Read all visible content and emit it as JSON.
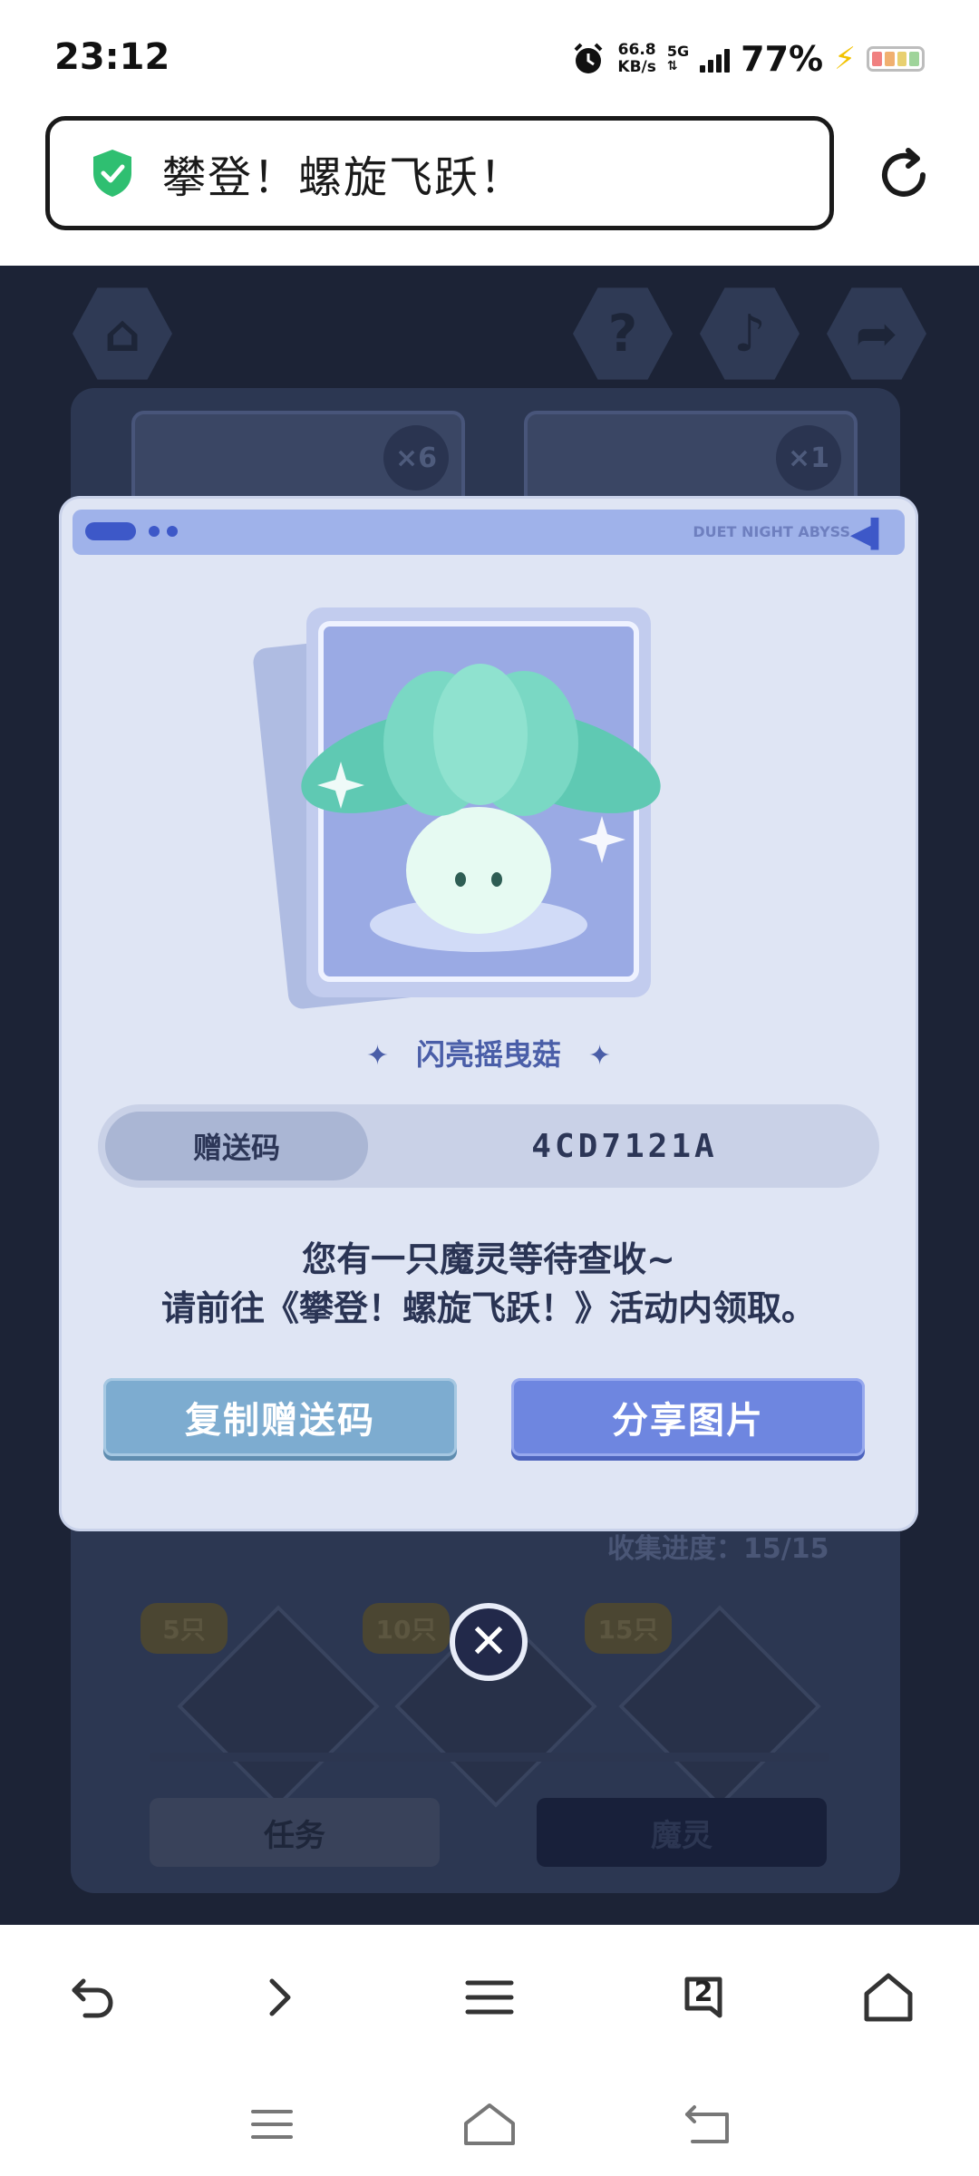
{
  "status_bar": {
    "time": "23:12",
    "net_speed_value": "66.8",
    "net_speed_unit": "KB/s",
    "network_type": "5G",
    "battery_percent": "77%",
    "icons": [
      "alarm-icon",
      "signal-icon",
      "charging-icon",
      "battery-icon"
    ]
  },
  "address_bar": {
    "title": "攀登！螺旋飞跃！",
    "secure_icon": "shield-check-icon",
    "reload_icon": "reload-icon",
    "accent_color": "#2fbf71"
  },
  "page": {
    "top_icons": [
      "home-icon",
      "help-icon",
      "music-icon",
      "share-icon"
    ],
    "card_counts": [
      "×6",
      "×1"
    ],
    "progress_text": "收集进度：15/15",
    "milestones": [
      "5只",
      "10只",
      "15只"
    ],
    "tabs": [
      "任务",
      "魔灵"
    ]
  },
  "dialog": {
    "header_brand": "DUET NIGHT ABYSS",
    "header_arrows": "◀▍",
    "spirit_name": "闪亮摇曳菇",
    "code_label": "赠送码",
    "code_value": "4CD7121A",
    "message_line1": "您有一只魔灵等待查收~",
    "message_line2": "请前往《攀登！螺旋飞跃！》活动内领取。",
    "copy_button": "复制赠送码",
    "share_button": "分享图片",
    "close_label": "✕",
    "accent_color": "#6e86e0"
  },
  "browser_toolbar": {
    "items": [
      "back-icon",
      "forward-icon",
      "menu-icon",
      "tabs-icon",
      "home-icon"
    ],
    "tab_count": "2"
  },
  "system_nav": {
    "items": [
      "recents-icon",
      "home-icon",
      "back-icon"
    ]
  }
}
